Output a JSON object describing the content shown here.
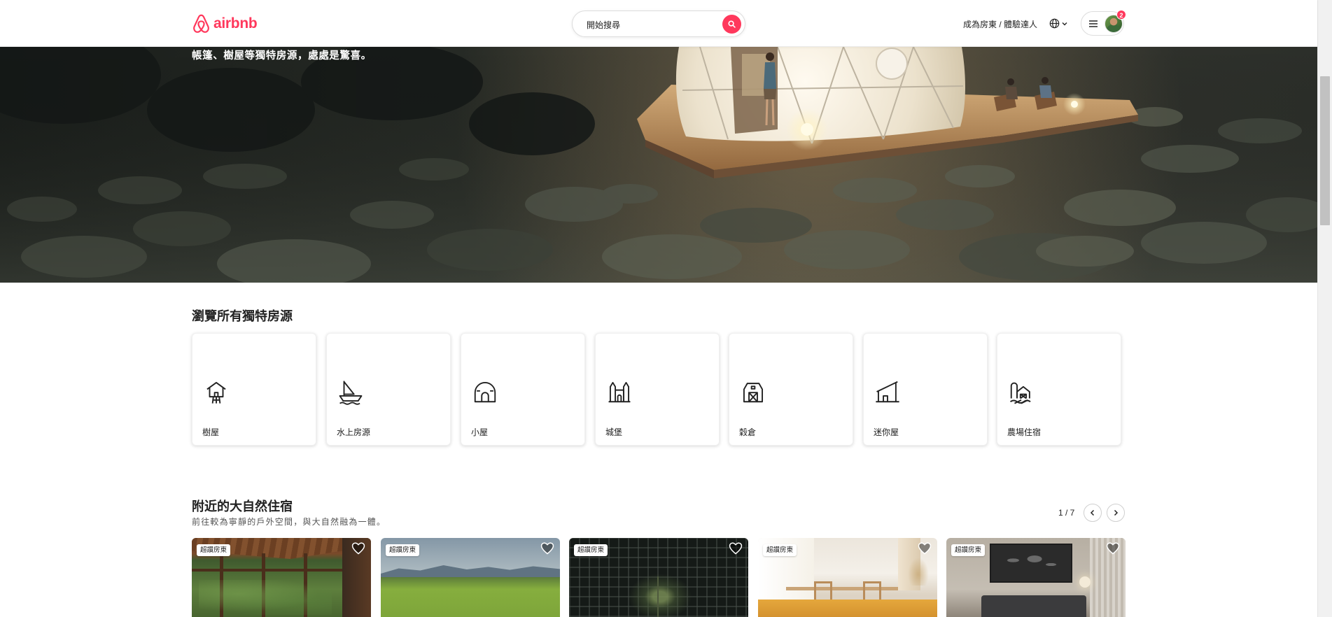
{
  "header": {
    "logo_text": "airbnb",
    "logo_icon": "airbnb-logo-icon",
    "search": {
      "placeholder": "開始搜尋",
      "icon": "search-icon"
    },
    "host_link": "成為房東 / 體驗達人",
    "language_icon": "globe-icon",
    "menu_icon": "hamburger-menu-icon",
    "notification_count": "2"
  },
  "hero": {
    "subtitle": "帳篷、樹屋等獨特房源，處處是驚喜。"
  },
  "unique_stays": {
    "title": "瀏覽所有獨特房源",
    "categories": [
      {
        "label": "樹屋",
        "icon": "treehouse-icon"
      },
      {
        "label": "水上房源",
        "icon": "houseboat-icon"
      },
      {
        "label": "小屋",
        "icon": "hut-icon"
      },
      {
        "label": "城堡",
        "icon": "castle-icon"
      },
      {
        "label": "穀倉",
        "icon": "barn-icon"
      },
      {
        "label": "迷你屋",
        "icon": "tiny-house-icon"
      },
      {
        "label": "農場住宿",
        "icon": "farm-icon"
      }
    ]
  },
  "nature_stays": {
    "title": "附近的大自然住宿",
    "subtitle": "前往較為寧靜的戶外空間，與大自然融為一體。",
    "page_indicator": "1 / 7",
    "prev_icon": "chevron-left-icon",
    "next_icon": "chevron-right-icon",
    "listings": [
      {
        "badge": "超讚房東",
        "favorite_icon": "heart-icon"
      },
      {
        "badge": "超讚房東",
        "favorite_icon": "heart-icon"
      },
      {
        "badge": "超讚房東",
        "favorite_icon": "heart-icon"
      },
      {
        "badge": "超讚房東",
        "favorite_icon": "heart-icon"
      },
      {
        "badge": "超讚房東",
        "favorite_icon": "heart-icon"
      }
    ]
  },
  "colors": {
    "brand": "#FF385C",
    "text": "#222222",
    "muted_text": "#555555",
    "border": "#DDDDDD"
  }
}
